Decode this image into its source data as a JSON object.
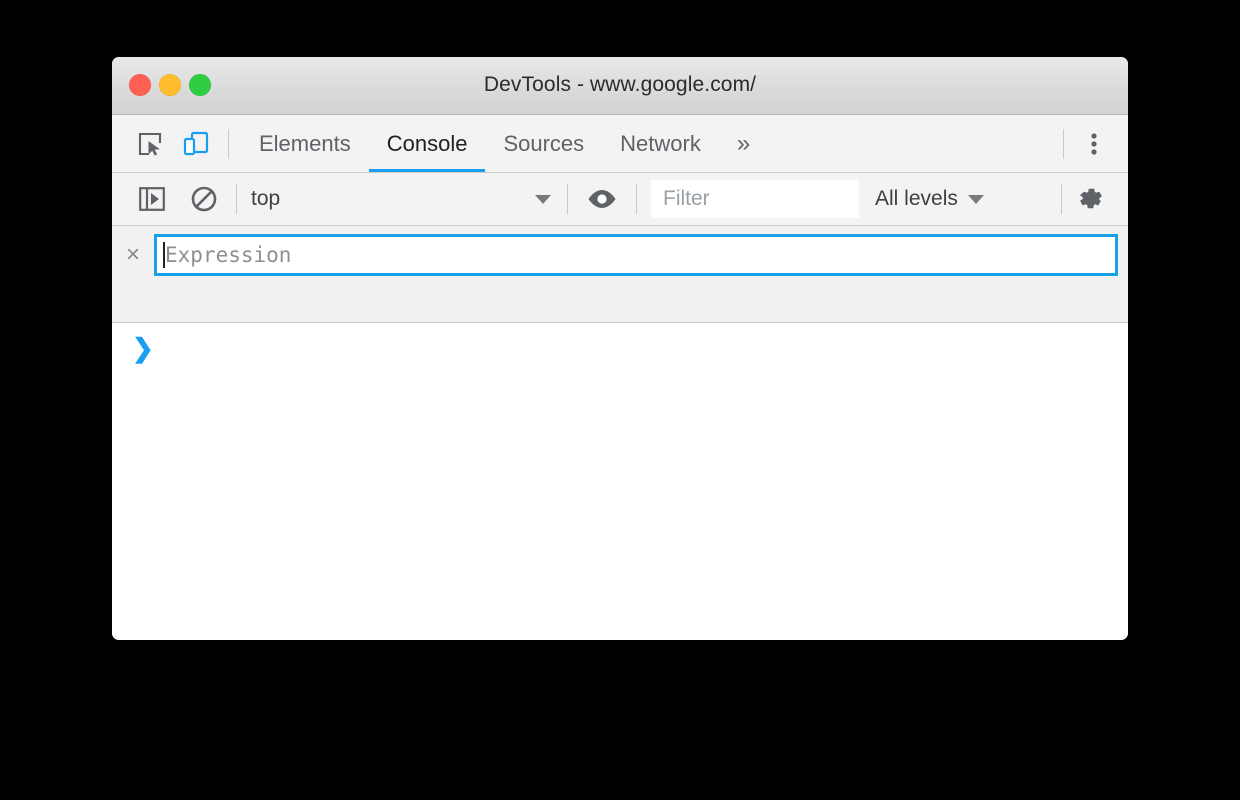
{
  "window": {
    "title": "DevTools - www.google.com/",
    "traffic_lights": [
      {
        "name": "close",
        "color": "#ff6054"
      },
      {
        "name": "minimize",
        "color": "#ffbd2e"
      },
      {
        "name": "maximize",
        "color": "#2ecc40"
      }
    ]
  },
  "tabbar": {
    "inspect_icon": "inspect-element-icon",
    "device_icon": "device-toolbar-icon",
    "tabs": [
      {
        "label": "Elements",
        "active": false
      },
      {
        "label": "Console",
        "active": true
      },
      {
        "label": "Sources",
        "active": false
      },
      {
        "label": "Network",
        "active": false
      }
    ],
    "more_tabs_label": "»",
    "kebab_icon": "more-options-icon",
    "active_underline_color": "#1a9ff0"
  },
  "console_toolbar": {
    "sidebar_icon": "show-console-sidebar-icon",
    "clear_icon": "clear-console-icon",
    "context": {
      "value": "top",
      "caret": "chevron-down-icon"
    },
    "live_expression_icon": "eye-icon",
    "filter": {
      "value": "",
      "placeholder": "Filter"
    },
    "levels": {
      "value": "All levels",
      "caret": "chevron-down-icon"
    },
    "settings_icon": "settings-gear-icon"
  },
  "watch_pane": {
    "remove_label": "×",
    "expression": {
      "value": "",
      "placeholder": "Expression",
      "focus_border_color": "#18a0e8"
    }
  },
  "console_output": {
    "prompt_chevron": "❯",
    "prompt_value": "",
    "messages": []
  }
}
